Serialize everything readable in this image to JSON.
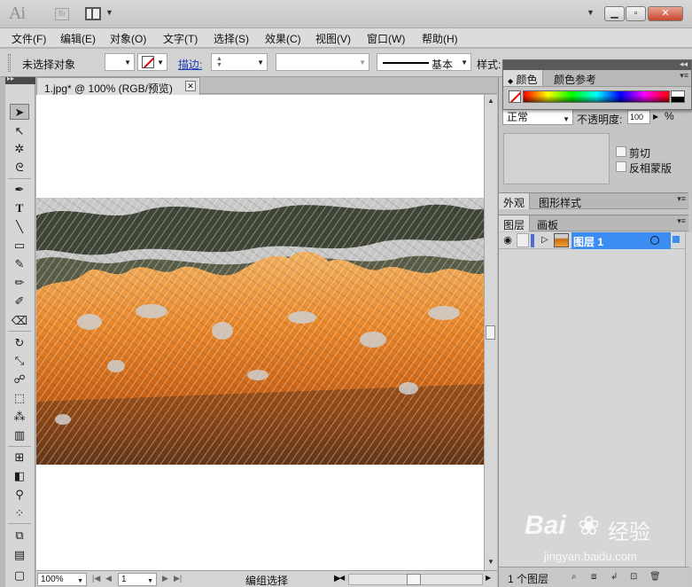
{
  "titlebar": {
    "app_logo": "Ai",
    "bridge_label": "Br"
  },
  "menu": [
    "文件(F)",
    "编辑(E)",
    "对象(O)",
    "文字(T)",
    "选择(S)",
    "效果(C)",
    "视图(V)",
    "窗口(W)",
    "帮助(H)"
  ],
  "control": {
    "selection_status": "未选择对象",
    "stroke_label": "描边:",
    "brush_label": "基本",
    "style_label": "样式:"
  },
  "document": {
    "tab_title": "1.jpg* @ 100% (RGB/预览)"
  },
  "statusbar": {
    "zoom": "100%",
    "artboard": "1",
    "tool_status": "编组选择"
  },
  "color_panel": {
    "tabs": [
      "颜色",
      "颜色参考"
    ]
  },
  "transparency": {
    "blend_mode": "正常",
    "opacity_label": "不透明度:",
    "opacity_value": "100",
    "opacity_unit": "%",
    "clip_label": "剪切",
    "invert_label": "反相蒙版"
  },
  "appearance_panel": {
    "tabs": [
      "外观",
      "图形样式"
    ]
  },
  "layers_panel": {
    "tabs": [
      "图层",
      "画板"
    ],
    "layer_name": "图层 1",
    "layer_count": "1 个图层"
  },
  "watermark": {
    "brand": "Bai",
    "brand_cn": "经验",
    "url": "jingyan.baidu.com"
  },
  "colors": {
    "selection_blue": "#3c8df2",
    "stroke_link": "#1a3fb8"
  }
}
